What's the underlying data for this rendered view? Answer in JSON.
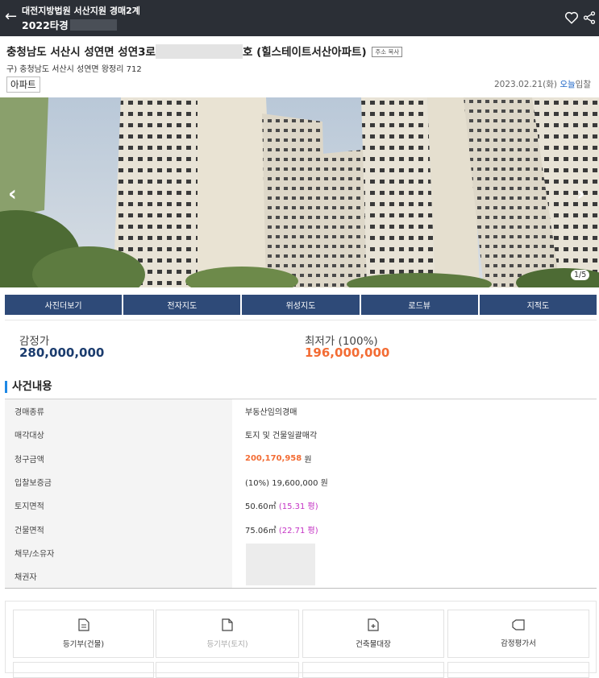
{
  "header": {
    "court": "대전지방법원 서산지원 경매2계",
    "case_no": "2022타경"
  },
  "property": {
    "address": "충청남도 서산시 성연면 성연3로",
    "address_suffix": "호 (힐스테이트서산아파트)",
    "copy_label": "주소 복사",
    "old_address": "구) 충청남도 서산시 성연면 왕정리 712",
    "type": "아파트",
    "date": "2023.02.21(화)",
    "today_label": "오늘",
    "bid_label": "입찰"
  },
  "photo": {
    "counter": "1/5"
  },
  "tabs": [
    "사진더보기",
    "전자지도",
    "위성지도",
    "로드뷰",
    "지적도"
  ],
  "price": {
    "appraisal_label": "감정가",
    "appraisal_value": "280,000,000",
    "minimum_label": "최저가 (100%)",
    "minimum_value": "196,000,000"
  },
  "case_section": {
    "title": "사건내용",
    "rows": {
      "auction_type": {
        "label": "경매종류",
        "value": "부동산임의경매"
      },
      "target": {
        "label": "매각대상",
        "value": "토지 및 건물일괄매각"
      },
      "claim": {
        "label": "청구금액",
        "amount": "200,170,958",
        "unit": "원"
      },
      "deposit": {
        "label": "입찰보증금",
        "value": "(10%) 19,600,000 원"
      },
      "land_area": {
        "label": "토지면적",
        "value": "50.60㎡",
        "pyeong": "(15.31 평)"
      },
      "building_area": {
        "label": "건물면적",
        "value": "75.06㎡",
        "pyeong": "(22.71 평)"
      },
      "owner": {
        "label": "채무/소유자"
      },
      "creditor": {
        "label": "채권자"
      }
    }
  },
  "documents": [
    {
      "label": "등기부(건물)",
      "icon": "document-icon"
    },
    {
      "label": "등기부(토지)",
      "icon": "file-icon"
    },
    {
      "label": "건축물대장",
      "icon": "file-plus-icon"
    },
    {
      "label": "감정평가서",
      "icon": "tag-icon"
    }
  ],
  "colors": {
    "header_bg": "#2b2f36",
    "tab_bg": "#2e4a78",
    "appraisal": "#1b3c6e",
    "minimum": "#f36c34",
    "pyeong": "#c433c4",
    "accent": "#1e88e5"
  }
}
